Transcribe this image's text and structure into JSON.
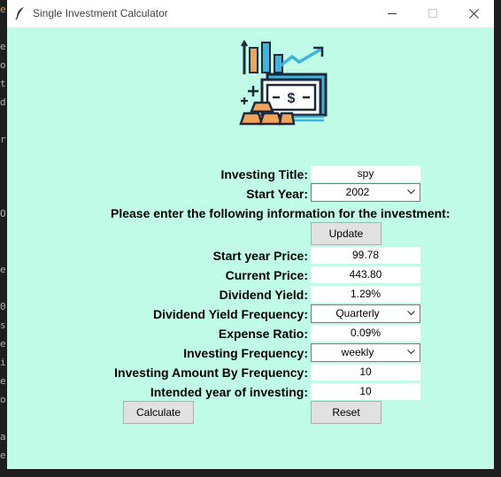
{
  "window": {
    "title": "Single Investment Calculator",
    "background": "#c0fbe8"
  },
  "form": {
    "investing_title": {
      "label": "Investing Title:",
      "value": "spy"
    },
    "start_year": {
      "label": "Start Year:",
      "selected": "2002"
    },
    "instruction": "Please enter the following information for the investment:",
    "update_button": "Update",
    "start_year_price": {
      "label": "Start year Price:",
      "value": "99.78"
    },
    "current_price": {
      "label": "Current Price:",
      "value": "443.80"
    },
    "dividend_yield": {
      "label": "Dividend Yield:",
      "value": "1.29%"
    },
    "dividend_frequency": {
      "label": "Dividend Yield Frequency:",
      "selected": "Quarterly"
    },
    "expense_ratio": {
      "label": "Expense Ratio:",
      "value": "0.09%"
    },
    "investing_frequency": {
      "label": "Investing Frequency:",
      "selected": "weekly"
    },
    "amount_by_frequency": {
      "label": "Investing Amount By Frequency:",
      "value": "10"
    },
    "intended_years": {
      "label": "Intended year of investing:",
      "value": "10"
    },
    "calculate_button": "Calculate",
    "reset_button": "Reset"
  },
  "icons": {
    "app": "feather-icon",
    "hero": "investment-money-gold-chart-icon"
  }
}
